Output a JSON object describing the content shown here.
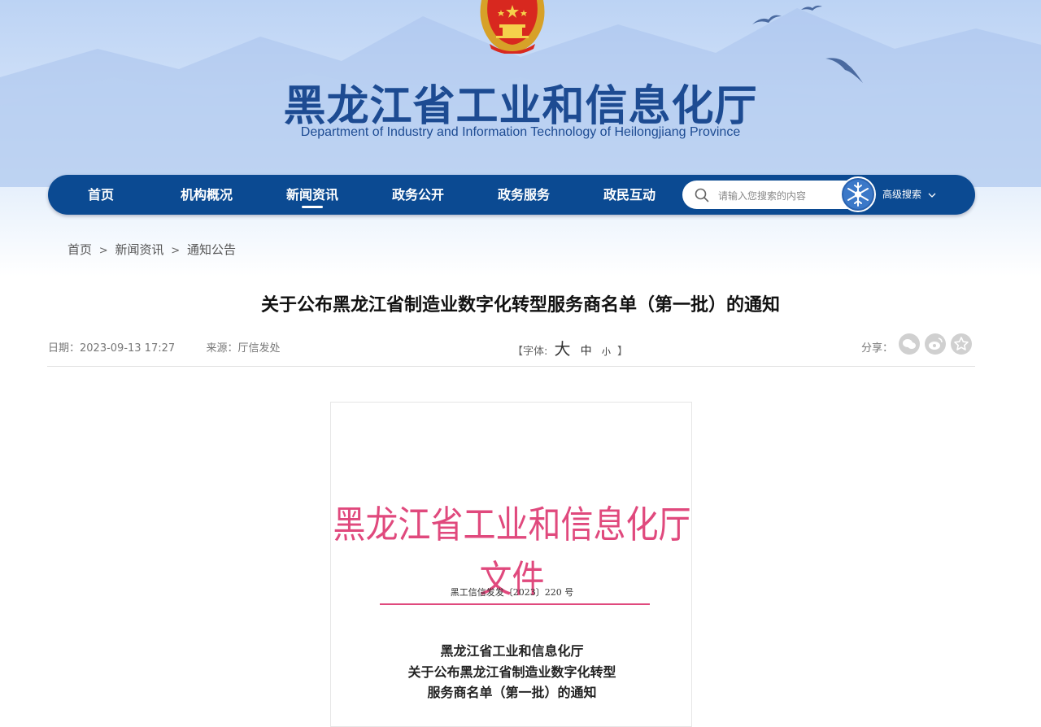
{
  "header": {
    "title_cn": "黑龙江省工业和信息化厅",
    "title_en": "Department of Industry and Information Technology of Heilongjiang Province"
  },
  "nav": {
    "items": [
      {
        "label": "首页"
      },
      {
        "label": "机构概况"
      },
      {
        "label": "新闻资讯",
        "active": true
      },
      {
        "label": "政务公开"
      },
      {
        "label": "政务服务"
      },
      {
        "label": "政民互动"
      }
    ],
    "search_placeholder": "请输入您搜索的内容",
    "advanced_search_label": "高级搜索"
  },
  "breadcrumb": {
    "items": [
      "首页",
      "新闻资讯",
      "通知公告"
    ],
    "separator": ">"
  },
  "article": {
    "title": "关于公布黑龙江省制造业数字化转型服务商名单（第一批）的通知",
    "date": "日期：2023-09-13 17:27",
    "source": "来源：厅信发处",
    "font_size": {
      "open": "【字体:",
      "large": "大",
      "medium": "中",
      "small": "小",
      "close": "】"
    },
    "share_label": "分享："
  },
  "document": {
    "header": "黑龙江省工业和信息化厅文件",
    "number": "黑工信信发发〔2023〕220 号",
    "title_lines": [
      "黑龙江省工业和信息化厅",
      "关于公布黑龙江省制造业数字化转型",
      "服务商名单（第一批）的通知"
    ]
  },
  "colors": {
    "nav_bg": "#0b4a92",
    "title_blue": "#1d4b92",
    "doc_red": "#e0497d"
  }
}
